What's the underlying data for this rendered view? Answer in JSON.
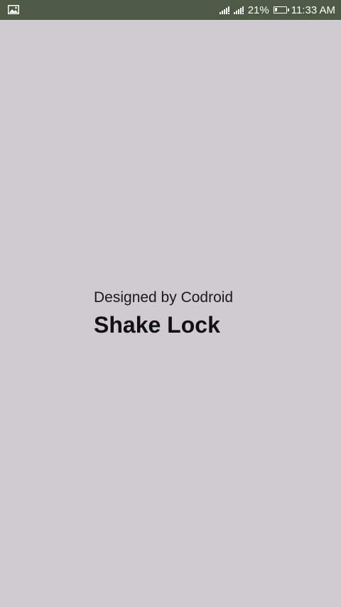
{
  "status_bar": {
    "left_icon": "image-icon",
    "battery_percent_text": "21%",
    "battery_level": 0.21,
    "time": "11:33 AM",
    "icons": [
      "signal-icon",
      "signal-icon",
      "battery-icon"
    ],
    "background": "#4d5b46"
  },
  "splash": {
    "subtitle": "Designed by Codroid",
    "title": "Shake Lock",
    "background": "#cfcbd1"
  }
}
